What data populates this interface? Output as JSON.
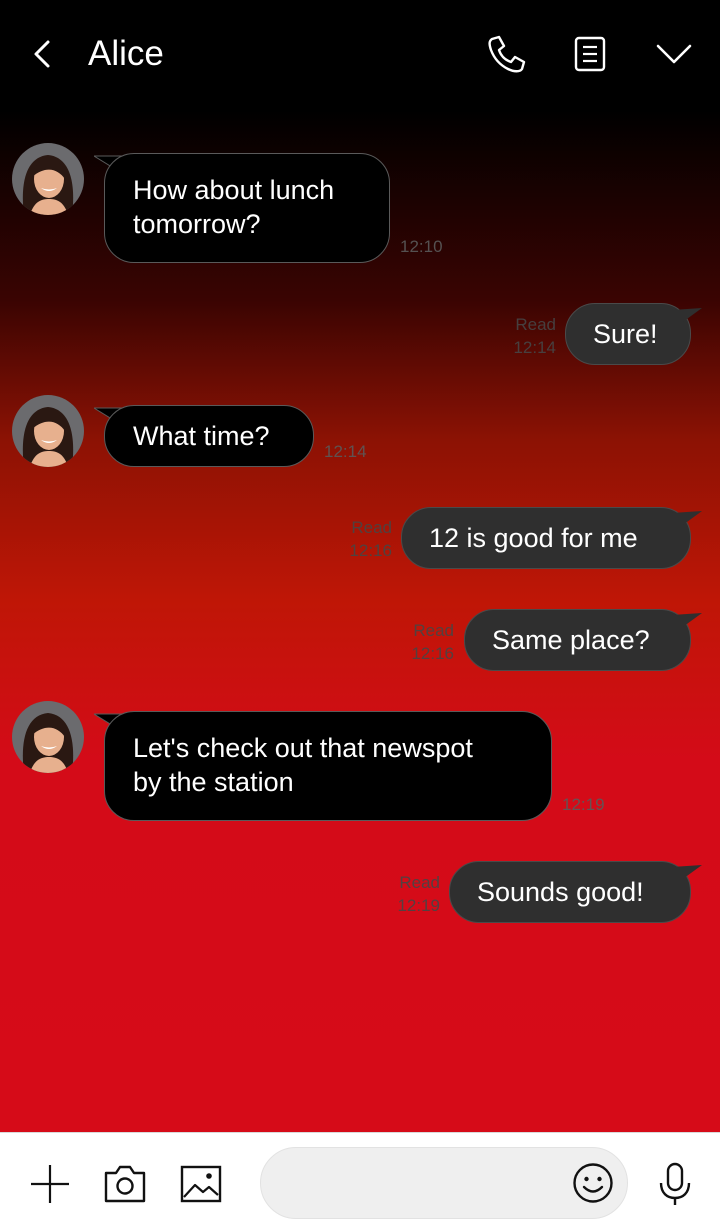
{
  "header": {
    "title": "Alice",
    "back_icon": "back-arrow-icon",
    "call_icon": "phone-icon",
    "note_icon": "notes-icon",
    "menu_icon": "chevron-down-icon"
  },
  "messages": [
    {
      "side": "in",
      "lines": [
        "How about lunch",
        "tomorrow?"
      ],
      "time": "12:10"
    },
    {
      "side": "out",
      "text": "Sure!",
      "read": "Read",
      "time": "12:14"
    },
    {
      "side": "in",
      "lines": [
        "What time?"
      ],
      "time": "12:14"
    },
    {
      "side": "out",
      "text": "12 is good for me",
      "read": "Read",
      "time": "12:16"
    },
    {
      "side": "out",
      "text": "Same place?",
      "read": "Read",
      "time": "12:16"
    },
    {
      "side": "in",
      "lines": [
        "Let's check out that newspot",
        "by the station"
      ],
      "time": "12:19"
    },
    {
      "side": "out",
      "text": "Sounds good!",
      "read": "Read",
      "time": "12:19"
    }
  ],
  "input": {
    "placeholder": "",
    "plus_icon": "plus-icon",
    "camera_icon": "camera-icon",
    "image_icon": "image-icon",
    "emoji_icon": "emoji-icon",
    "mic_icon": "microphone-icon"
  },
  "colors": {
    "incoming_bubble": "#000000",
    "outgoing_bubble": "#2f2f2f",
    "background_top": "#000000",
    "background_bottom": "#d60b18"
  }
}
